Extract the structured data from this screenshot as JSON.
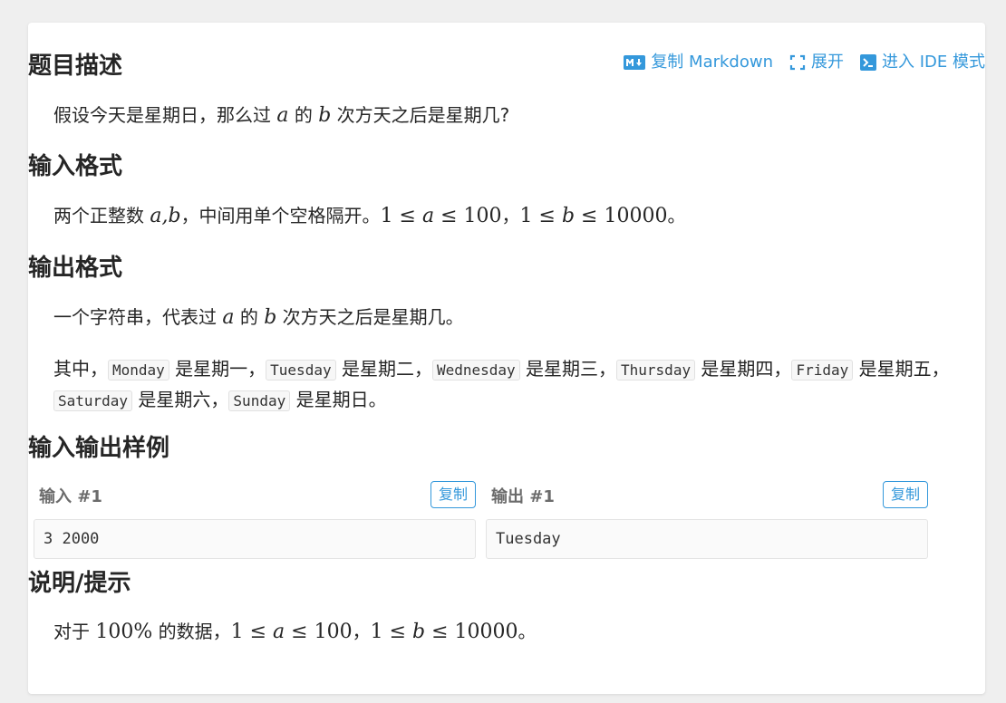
{
  "header": {
    "title": "题目描述",
    "actions": {
      "copy_markdown": "复制 Markdown",
      "expand": "展开",
      "ide_mode": "进入 IDE 模式"
    }
  },
  "description": {
    "t1": "假设今天是星期日，那么过 ",
    "var_a": "a",
    "t2": " 的 ",
    "var_b": "b",
    "t3": " 次方天之后是星期几?"
  },
  "input_format": {
    "title": "输入格式",
    "t1": "两个正整数 ",
    "vars": "a,b",
    "t2": "，中间用单个空格隔开。",
    "c1_pre": "1 ≤ ",
    "c1_var": "a",
    "c1_post": " ≤ 100",
    "sep": "，",
    "c2_pre": "1 ≤ ",
    "c2_var": "b",
    "c2_post": " ≤ 10000",
    "end": "。"
  },
  "output_format": {
    "title": "输出格式",
    "t1": "一个字符串，代表过 ",
    "var_a": "a",
    "t2": " 的 ",
    "var_b": "b",
    "t3": " 次方天之后是星期几。",
    "lead": "其中，",
    "days": [
      {
        "code": "Monday",
        "text": " 是星期一，"
      },
      {
        "code": "Tuesday",
        "text": " 是星期二，"
      },
      {
        "code": "Wednesday",
        "text": " 是星期三，"
      },
      {
        "code": "Thursday",
        "text": " 是星期四，"
      },
      {
        "code": "Friday",
        "text": " 是星期五，"
      },
      {
        "code": "Saturday",
        "text": " 是星期六，"
      },
      {
        "code": "Sunday",
        "text": " 是星期日。"
      }
    ]
  },
  "samples": {
    "title": "输入输出样例",
    "input_label": "输入 #1",
    "output_label": "输出 #1",
    "copy_label": "复制",
    "input_value": "3 2000",
    "output_value": "Tuesday"
  },
  "hint": {
    "title": "说明/提示",
    "t1": "对于 ",
    "pct": "100%",
    "t2": " 的数据，",
    "c1_pre": "1 ≤ ",
    "c1_var": "a",
    "c1_post": " ≤ 100",
    "sep": "，",
    "c2_pre": "1 ≤ ",
    "c2_var": "b",
    "c2_post": " ≤ 10000",
    "end": "。"
  },
  "colors": {
    "accent": "#3498db",
    "background": "#efefef",
    "card": "#ffffff"
  }
}
